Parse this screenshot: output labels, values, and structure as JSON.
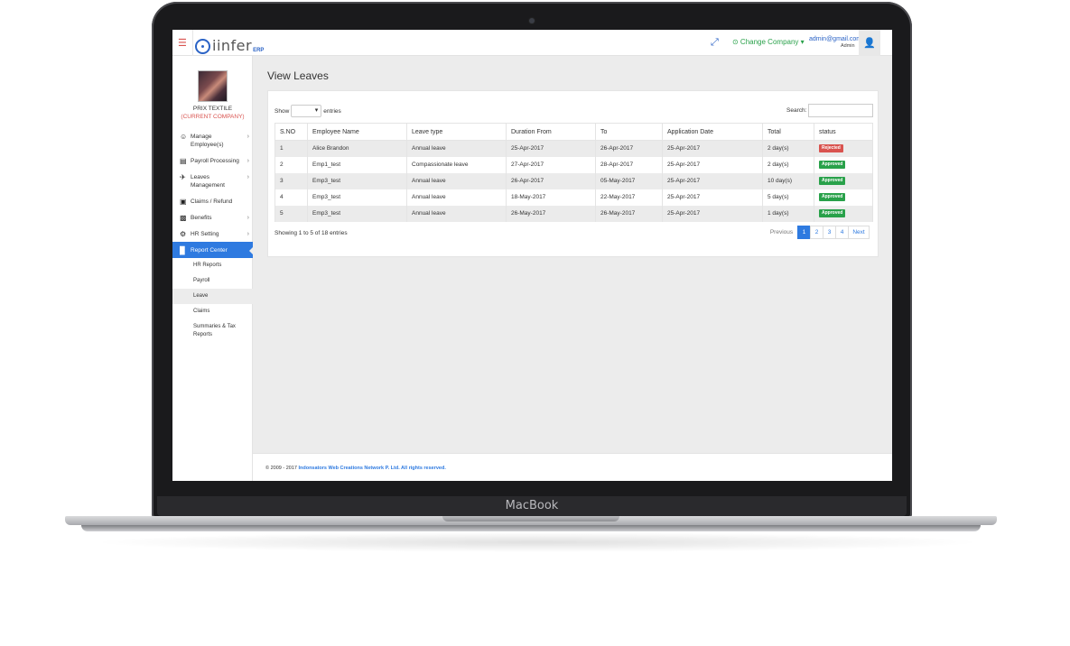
{
  "device": {
    "brand": "MacBook"
  },
  "header": {
    "logo_text": "iinfer",
    "logo_suffix": "ERP",
    "change_company": "⊙ Change Company ▾",
    "user_email": "admin@gmail.com",
    "user_role": "Admin"
  },
  "sidebar": {
    "company_name": "PRIX TEXTILE",
    "company_sub": "(CURRENT COMPANY)",
    "items": [
      {
        "label": "Manage Employee(s)",
        "icon": "user-icon"
      },
      {
        "label": "Payroll Processing",
        "icon": "card-icon"
      },
      {
        "label": "Leaves Management",
        "icon": "plane-icon"
      },
      {
        "label": "Claims / Refund",
        "icon": "money-icon"
      },
      {
        "label": "Benefits",
        "icon": "gift-icon"
      },
      {
        "label": "HR Setting",
        "icon": "gear-icon"
      },
      {
        "label": "Report Center",
        "icon": "bar-chart-icon"
      }
    ],
    "submenu": [
      {
        "label": "HR Reports"
      },
      {
        "label": "Payroll"
      },
      {
        "label": "Leave"
      },
      {
        "label": "Claims"
      },
      {
        "label": "Summaries & Tax Reports"
      }
    ]
  },
  "main": {
    "title": "View Leaves",
    "show_label": "Show",
    "entries_label": "entries",
    "search_label": "Search:",
    "columns": [
      "S.NO",
      "Employee Name",
      "Leave type",
      "Duration From",
      "To",
      "Application Date",
      "Total",
      "status"
    ],
    "rows": [
      {
        "sno": "1",
        "name": "Alice Brandon",
        "type": "Annual leave",
        "from": "25-Apr-2017",
        "to": "26-Apr-2017",
        "applied": "25-Apr-2017",
        "total": "2 day(s)",
        "status": "Rejected"
      },
      {
        "sno": "2",
        "name": "Emp1_test",
        "type": "Compassionate leave",
        "from": "27-Apr-2017",
        "to": "28-Apr-2017",
        "applied": "25-Apr-2017",
        "total": "2 day(s)",
        "status": "Approved"
      },
      {
        "sno": "3",
        "name": "Emp3_test",
        "type": "Annual leave",
        "from": "26-Apr-2017",
        "to": "05-May-2017",
        "applied": "25-Apr-2017",
        "total": "10 day(s)",
        "status": "Approved"
      },
      {
        "sno": "4",
        "name": "Emp3_test",
        "type": "Annual leave",
        "from": "18-May-2017",
        "to": "22-May-2017",
        "applied": "25-Apr-2017",
        "total": "5 day(s)",
        "status": "Approved"
      },
      {
        "sno": "5",
        "name": "Emp3_test",
        "type": "Annual leave",
        "from": "26-May-2017",
        "to": "26-May-2017",
        "applied": "25-Apr-2017",
        "total": "1 day(s)",
        "status": "Approved"
      }
    ],
    "info": "Showing 1 to 5 of 18 entries",
    "pagination": {
      "previous": "Previous",
      "pages": [
        "1",
        "2",
        "3",
        "4"
      ],
      "next": "Next",
      "current": "1"
    }
  },
  "footer": {
    "text": "© 2009 - 2017 ",
    "link": "Indonsators Web Creations Network P. Ltd. All rights reserved."
  },
  "colors": {
    "accent": "#2e7ae0",
    "rejected": "#d9534f",
    "approved": "#29a14a",
    "change_company": "#29a14a"
  }
}
